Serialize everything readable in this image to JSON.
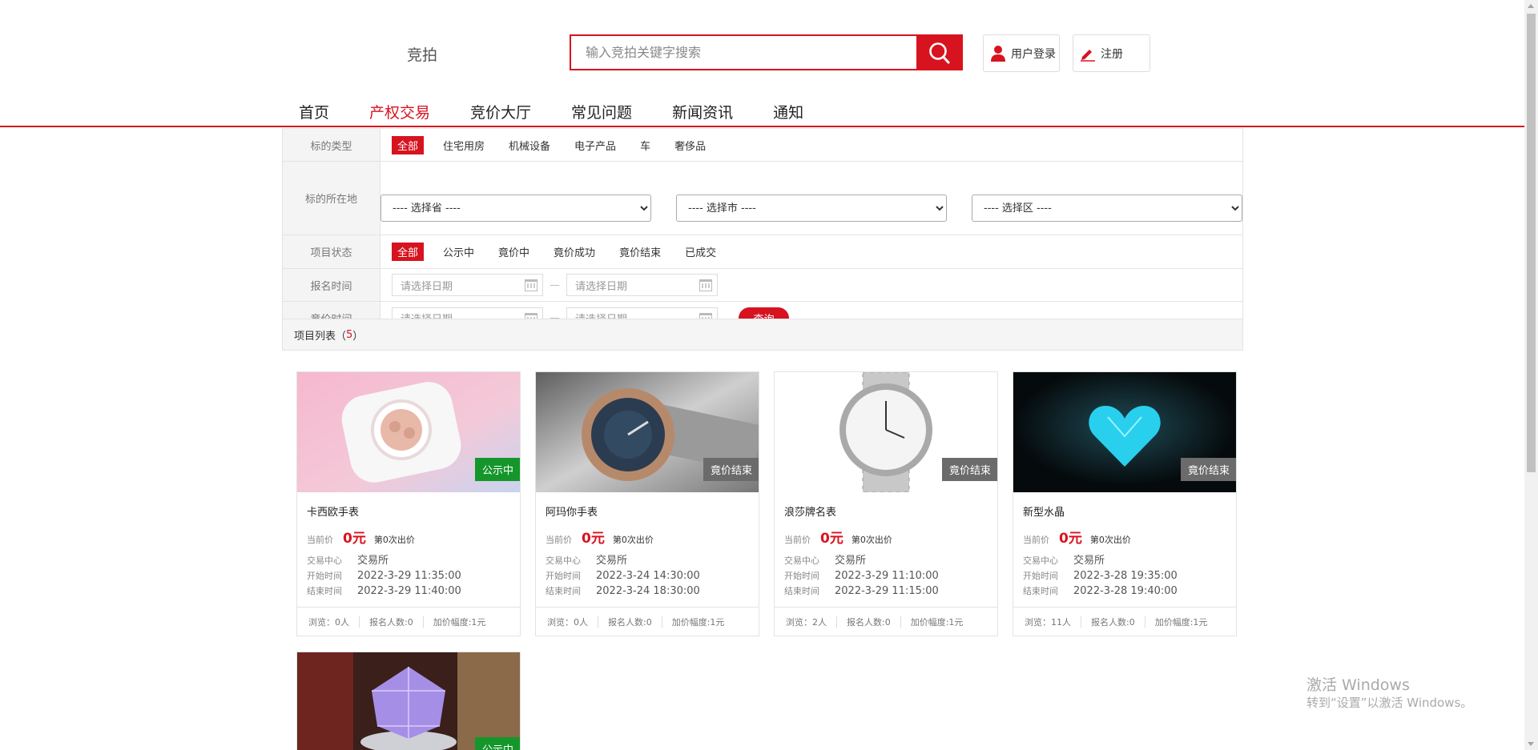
{
  "header": {
    "logo": "竞拍",
    "search_placeholder": "输入竞拍关键字搜索",
    "login_label": "用户登录",
    "register_label": "注册"
  },
  "nav": [
    "首页",
    "产权交易",
    "竞价大厅",
    "常见问题",
    "新闻资讯",
    "通知"
  ],
  "nav_active": "产权交易",
  "filters": {
    "type_label": "标的类型",
    "type_options": [
      "全部",
      "住宅用房",
      "机械设备",
      "电子产品",
      "车",
      "奢侈品"
    ],
    "location_label": "标的所在地",
    "province": "---- 选择省 ----",
    "city": "---- 选择市 ----",
    "district": "---- 选择区 ----",
    "status_label": "项目状态",
    "status_options": [
      "全部",
      "公示中",
      "竟价中",
      "竟价成功",
      "竟价结束",
      "已成交"
    ],
    "signup_label": "报名时间",
    "bid_label": "竞价时间",
    "date_placeholder": "请选择日期",
    "dash": "—",
    "query_label": "查询"
  },
  "list": {
    "title": "项目列表（",
    "count": "5",
    "close": "）"
  },
  "card_labels": {
    "price": "当前价",
    "center": "交易中心",
    "start": "开始时间",
    "end": "结束时间"
  },
  "cards": [
    {
      "title": "卡西欧手表",
      "price": "0元",
      "bids": "第0次出价",
      "center": "交易所",
      "start": "2022-3-29 11:35:00",
      "end": "2022-3-29 11:40:00",
      "views": "浏览：0人",
      "signups": "报名人数:0",
      "increment": "加价幅度:1元",
      "badge": "公示中",
      "badge_color": "#15962b"
    },
    {
      "title": "阿玛你手表",
      "price": "0元",
      "bids": "第0次出价",
      "center": "交易所",
      "start": "2022-3-24 14:30:00",
      "end": "2022-3-24 18:30:00",
      "views": "浏览：0人",
      "signups": "报名人数:0",
      "increment": "加价幅度:1元",
      "badge": "竟价结束",
      "badge_color": "#6b6b6b"
    },
    {
      "title": "浪莎牌名表",
      "price": "0元",
      "bids": "第0次出价",
      "center": "交易所",
      "start": "2022-3-29 11:10:00",
      "end": "2022-3-29 11:15:00",
      "views": "浏览：2人",
      "signups": "报名人数:0",
      "increment": "加价幅度:1元",
      "badge": "竟价结束",
      "badge_color": "#6b6b6b"
    },
    {
      "title": "新型水晶",
      "price": "0元",
      "bids": "第0次出价",
      "center": "交易所",
      "start": "2022-3-28 19:35:00",
      "end": "2022-3-28 19:40:00",
      "views": "浏览：11人",
      "signups": "报名人数:0",
      "increment": "加价幅度:1元",
      "badge": "竟价结束",
      "badge_color": "#6b6b6b"
    },
    {
      "badge": "公示中",
      "badge_color": "#15962b"
    }
  ],
  "watermark": {
    "line1": "激活 Windows",
    "line2": "转到“设置”以激活 Windows。"
  },
  "colors": {
    "accent": "#d7131f",
    "green": "#15962b",
    "gray": "#6b6b6b"
  }
}
